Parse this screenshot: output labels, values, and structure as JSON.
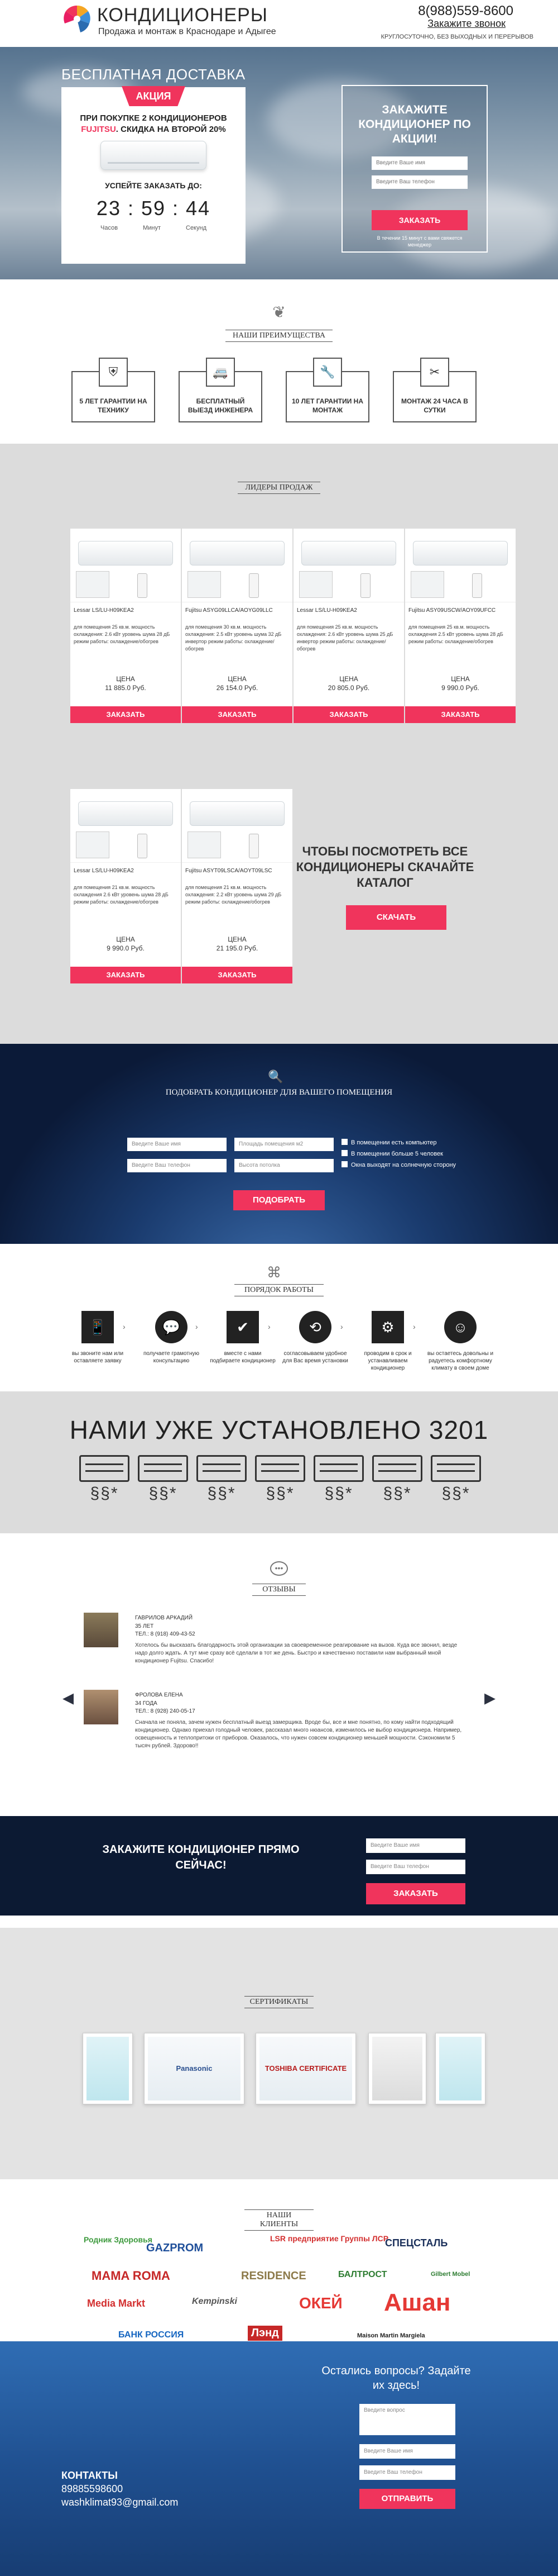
{
  "header": {
    "brand": "КОНДИЦИОНЕРЫ",
    "subtitle": "Продажа и монтаж в Краснодаре и Адыгее",
    "phone": "8(988)559-8600",
    "callback_label": "Закажите звонок",
    "hours": "КРУГЛОСУТОЧНО, БЕЗ ВЫХОДНЫХ И ПЕРЕРЫВОВ"
  },
  "hero": {
    "title": "БЕСПЛАТНАЯ ДОСТАВКА",
    "badge": "АКЦИЯ",
    "promo_line1": "ПРИ ПОКУПКЕ 2 КОНДИЦИОНЕРОВ",
    "promo_brand": "FUJITSU",
    "promo_line2": ". СКИДКА НА ВТОРОЙ 20%",
    "timer_label": "УСПЕЙТЕ ЗАКАЗАТЬ ДО:",
    "timer": "23 : 59 : 44",
    "timer_units": [
      "Часов",
      "Минут",
      "Секунд"
    ],
    "form_title": "ЗАКАЖИТЕ КОНДИЦИОНЕР ПО АКЦИИ!",
    "name_placeholder": "Введите Ваше имя",
    "phone_placeholder": "Введите Ваш телефон",
    "button": "ЗАКАЗАТЬ",
    "note": "В течении 15 минут с вами свяжется менеджер"
  },
  "advantages": {
    "heading": "НАШИ ПРЕИМУЩЕСТВА",
    "items": [
      {
        "icon": "shield-icon",
        "text": "5 ЛЕТ ГАРАНТИИ НА ТЕХНИКУ"
      },
      {
        "icon": "car-icon",
        "text": "БЕСПЛАТНЫЙ ВЫЕЗД ИНЖЕНЕРА"
      },
      {
        "icon": "wrench-icon",
        "text": "10 ЛЕТ ГАРАНТИИ НА МОНТАЖ"
      },
      {
        "icon": "tools-icon",
        "text": "МОНТАЖ 24 ЧАСА В СУТКИ"
      }
    ]
  },
  "leaders": {
    "heading": "ЛИДЕРЫ ПРОДАЖ",
    "price_label": "ЦЕНА",
    "button": "ЗАКАЗАТЬ",
    "products": [
      {
        "name": "Lessar LS/LU-H09KEA2",
        "desc": "для помещения 25 кв.м. мощность охлаждения: 2.6 кВт уровень шума 28 дБ режим работы: охлаждение/обогрев",
        "price": "11 885.0 Руб."
      },
      {
        "name": "Fujitsu ASYG09LLCA/AOYG09LLC",
        "desc": "для помещения 30 кв.м. мощность охлаждения: 2.5 кВт уровень шума 32 дБ инвертор режим работы: охлаждение/обогрев",
        "price": "26 154.0 Руб."
      },
      {
        "name": "Lessar LS/LU-H09KEA2",
        "desc": "для помещения 25 кв.м. мощность охлаждения: 2.6 кВт уровень шума 25 дБ инвертор режим работы: охлаждение/обогрев",
        "price": "20 805.0 Руб."
      },
      {
        "name": "Fujitsu ASY09USCW/AOY09UFCC",
        "desc": "для помещения 25 кв.м. мощность охлаждения 2.5 кВт уровень шума 28 дБ режим работы: охлаждение/обогрев",
        "price": "9 990.0 Руб."
      },
      {
        "name": "Lessar LS/LU-H09KEA2",
        "desc": "для помещения 21 кв.м. мощность охлаждения 2.6 кВт уровень шума 28 дБ режим работы: охлаждение/обогрев",
        "price": "9 990.0 Руб."
      },
      {
        "name": "Fujitsu ASYT09LSCA/AOYT09LSC",
        "desc": "для помещения 21 кв.м. мощность охлаждения: 2.2 кВт уровень шума 29 дБ режим работы: охлаждение/обогрев",
        "price": "21 195.0 Руб."
      }
    ],
    "catalog_title": "ЧТОБЫ ПОСМОТРЕТЬ ВСЕ КОНДИЦИОНЕРЫ СКАЧАЙТЕ КАТАЛОГ",
    "catalog_button": "СКАЧАТЬ"
  },
  "select": {
    "title": "ПОДОБРАТЬ КОНДИЦИОНЕР ДЛЯ ВАШЕГО ПОМЕЩЕНИЯ",
    "inputs": [
      "Введите Ваше имя",
      "Площадь помещения м2",
      "Введите Ваш телефон",
      "Высота потолка"
    ],
    "options": [
      "В помещении есть компьютер",
      "В помещении больше 5 человек",
      "Окна выходят на солнечную сторону"
    ],
    "button": "ПОДОБРАТЬ"
  },
  "steps": {
    "heading": "ПОРЯДОК РАБОТЫ",
    "items": [
      {
        "icon": "phone-icon",
        "text": "вы звоните нам или оставляете заявку"
      },
      {
        "icon": "chat-icon",
        "text": "получаете грамотную консультацию"
      },
      {
        "icon": "check-icon",
        "text": "вместе с нами подбираете кондиционер"
      },
      {
        "icon": "clock-icon",
        "text": "согласовываем удобное для Вас время установки"
      },
      {
        "icon": "gears-icon",
        "text": "проводим в срок и устанавливаем кондиционер"
      },
      {
        "icon": "smile-icon",
        "text": "вы остаетесь довольны и радуетесь комфортному климату в своем доме"
      }
    ]
  },
  "installed": {
    "title": "НАМИ УЖЕ УСТАНОВЛЕНО 3201"
  },
  "reviews": {
    "heading": "ОТЗЫВЫ",
    "items": [
      {
        "name": "ГАВРИЛОВ АРКАДИЙ",
        "age": "35 ЛЕТ",
        "phone": "ТЕЛ.: 8 (918) 409-43-52",
        "text": "Хотелось бы высказать благодарность этой организации за своевременное реагирование на вызов. Куда все звонил, везде надо долго ждать. А тут мне сразу всё сделали в тот же день. Быстро и качественно поставили нам выбранный мной кондиционер Fujitsu. Спасибо!"
      },
      {
        "name": "ФРОЛОВА ЕЛЕНА",
        "age": "34 ГОДА",
        "phone": "ТЕЛ.: 8 (928) 240-05-17",
        "text": "Сначала не поняла, зачем нужен бесплатный выезд замерщика. Вроде бы, все и мне понятно, по кому найти подходящий кондиционер. Однако приехал голодный человек, рассказал много нюансов, изменилось не выбор кондиционера. Например, освещенность и теплопритоки от приборов. Оказалось, что нужен совсем кондиционер меньшей мощности. Сэкономили 5 тысяч рублей. Здорово!!"
      }
    ]
  },
  "order_band": {
    "title": "ЗАКАЖИТЕ КОНДИЦИОНЕР ПРЯМО СЕЙЧАС!",
    "name_placeholder": "Введите Ваше имя",
    "phone_placeholder": "Введите Ваш телефон",
    "button": "ЗАКАЗАТЬ"
  },
  "certificates": {
    "heading": "СЕРТИФИКАТЫ",
    "items": [
      "",
      "Panasonic",
      "TOSHIBA CERTIFICATE",
      "",
      ""
    ]
  },
  "clients": {
    "heading": "НАШИ КЛИЕНТЫ",
    "logos": [
      "Родник Здоровья",
      "GAZPROM",
      "LSR предприятие Группы ЛСР",
      "СПЕЦСТАЛЬ",
      "MAMA ROMA",
      "RESIDENCE",
      "БАЛТРОСТ",
      "Gilbert Mobel",
      "Media Markt",
      "Kempinski",
      "ОКЕЙ",
      "Ашан",
      "БАНК РОССИЯ",
      "Лэнд",
      "Maison Martin Margiela"
    ]
  },
  "footer": {
    "question": "Остались вопросы? Задайте их здесь!",
    "question_placeholder": "Введите вопрос",
    "name_placeholder": "Введите Ваше имя",
    "phone_placeholder": "Введите Ваш телефон",
    "button": "ОТПРАВИТЬ",
    "contacts_label": "КОНТАКТЫ",
    "contacts_phone": "89885598600",
    "contacts_email": "washklimat93@gmail.com"
  },
  "colors": {
    "accent": "#f0345c",
    "dark_band": "#0c1a33",
    "footer_blue": "#2f6db4",
    "gray_section": "#dcdcdc"
  }
}
